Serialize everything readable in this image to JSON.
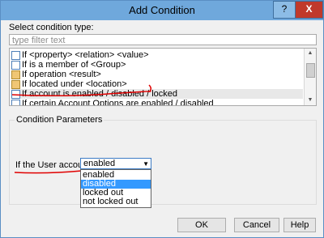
{
  "window": {
    "title": "Add Condition",
    "help_glyph": "?",
    "close_glyph": "X"
  },
  "condition_type": {
    "label": "Select condition type:",
    "filter_placeholder": "type filter text",
    "items": [
      {
        "label": "If <property> <relation> <value>",
        "icon": "grid-icon"
      },
      {
        "label": "If is a member of <Group>",
        "icon": "grid-icon"
      },
      {
        "label": "If operation <result>",
        "icon": "folder-icon"
      },
      {
        "label": "If located under <location>",
        "icon": "folder-icon"
      },
      {
        "label": "If account is enabled / disabled / locked",
        "icon": "grid-icon"
      },
      {
        "label": "If certain Account Options are enabled / disabled",
        "icon": "grid-icon"
      }
    ],
    "selected_index": 4
  },
  "parameters": {
    "group_title": "Condition Parameters",
    "field_label": "If the User account is",
    "select_value": "enabled",
    "options": [
      "enabled",
      "disabled",
      "locked out",
      "not locked out"
    ],
    "highlighted_index": 1
  },
  "buttons": {
    "ok": "OK",
    "cancel": "Cancel",
    "help": "Help"
  },
  "colors": {
    "titlebar": "#6fa8dc",
    "close_button": "#c0392b",
    "selection_highlight": "#3399ff",
    "annotation_red": "#e00000"
  }
}
